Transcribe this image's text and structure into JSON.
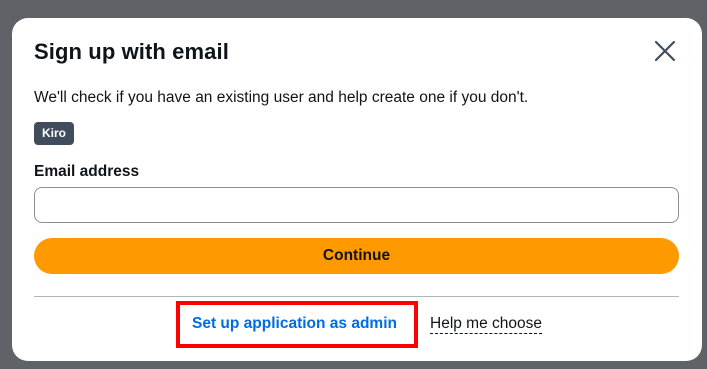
{
  "modal": {
    "title": "Sign up with email",
    "close_icon": "close-icon",
    "description": "We'll check if you have an existing user and help create one if you don't.",
    "badge": "Kiro",
    "email_label": "Email address",
    "email_value": "",
    "email_placeholder": "",
    "continue_label": "Continue",
    "admin_link": "Set up application as admin",
    "help_link": "Help me choose"
  },
  "colors": {
    "backdrop": "#5f6267",
    "primary_button": "#ff9900",
    "link": "#006ce0",
    "badge": "#414d5c",
    "highlight": "#ff0000"
  }
}
